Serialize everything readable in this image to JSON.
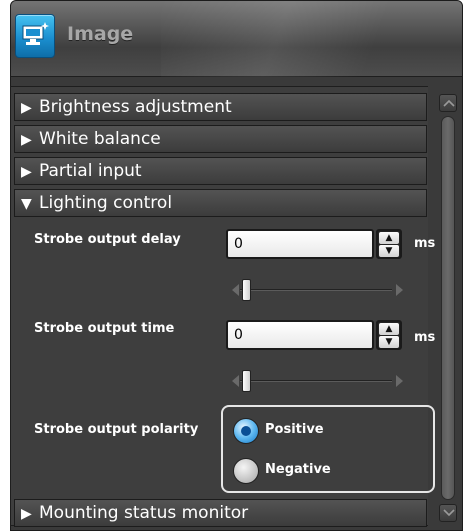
{
  "window": {
    "title": "Image"
  },
  "sections": [
    {
      "label": "Brightness adjustment",
      "expanded": false
    },
    {
      "label": "White balance",
      "expanded": false
    },
    {
      "label": "Partial input",
      "expanded": false
    },
    {
      "label": "Lighting control",
      "expanded": true
    },
    {
      "label": "Mounting status monitor",
      "expanded": false
    }
  ],
  "arrows": {
    "collapsed": "▶",
    "expanded": "▼"
  },
  "lighting": {
    "strobe_delay": {
      "label": "Strobe output delay",
      "value": "0",
      "unit": "ms",
      "slider_fraction": 0
    },
    "strobe_time": {
      "label": "Strobe output time",
      "value": "0",
      "unit": "ms",
      "slider_fraction": 0
    },
    "polarity": {
      "label": "Strobe output polarity",
      "options": [
        {
          "label": "Positive",
          "selected": true
        },
        {
          "label": "Negative",
          "selected": false
        }
      ]
    }
  },
  "colors": {
    "background": "#3e3e3e",
    "accent": "#1b8fd0"
  },
  "icons": {
    "app": "image-display-icon",
    "spin_up": "up-arrow-icon",
    "spin_down": "down-arrow-icon"
  }
}
